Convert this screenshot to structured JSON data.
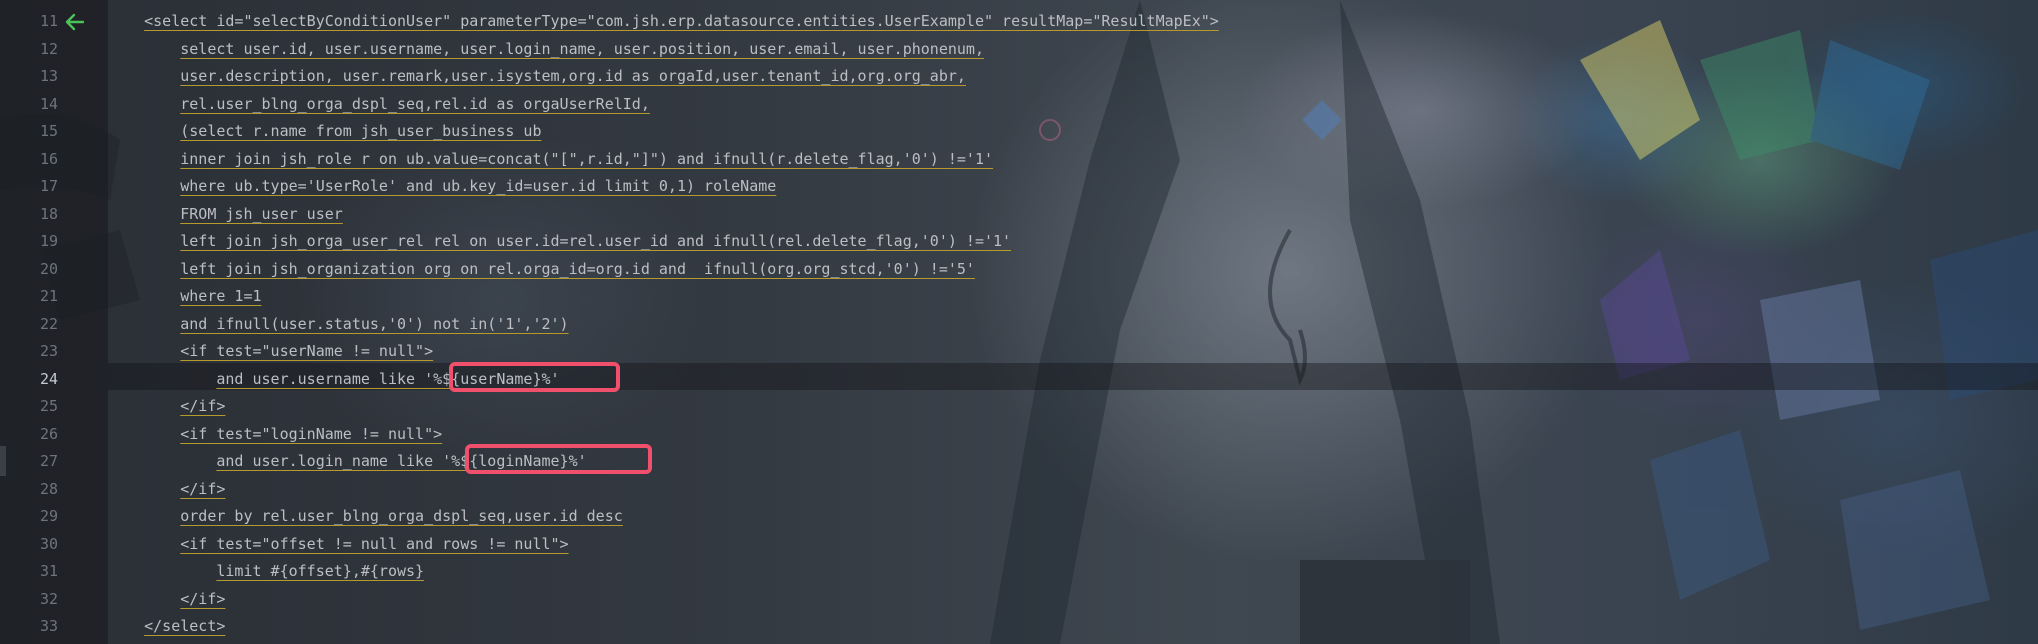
{
  "editor": {
    "colors": {
      "highlight_border": "#f0506b",
      "line_number": "#6e747d",
      "active_line_number": "#c5c9d0",
      "code_text": "#bcbec4",
      "warning_underline": "#b79a2e",
      "gutter_arrow": "#4cc25b"
    },
    "gutter_icon": "left-arrow-icon",
    "active_line": "24",
    "lines": [
      {
        "num": "11",
        "indent": "    ",
        "text": "<select id=\"selectByConditionUser\" parameterType=\"com.jsh.erp.datasource.entities.UserExample\" resultMap=\"ResultMapEx\">"
      },
      {
        "num": "12",
        "indent": "        ",
        "text": "select user.id, user.username, user.login_name, user.position, user.email, user.phonenum,"
      },
      {
        "num": "13",
        "indent": "        ",
        "text": "user.description, user.remark,user.isystem,org.id as orgaId,user.tenant_id,org.org_abr,"
      },
      {
        "num": "14",
        "indent": "        ",
        "text": "rel.user_blng_orga_dspl_seq,rel.id as orgaUserRelId,"
      },
      {
        "num": "15",
        "indent": "        ",
        "text": "(select r.name from jsh_user_business ub"
      },
      {
        "num": "16",
        "indent": "        ",
        "text": "inner join jsh_role r on ub.value=concat(\"[\",r.id,\"]\") and ifnull(r.delete_flag,'0') !='1'"
      },
      {
        "num": "17",
        "indent": "        ",
        "text": "where ub.type='UserRole' and ub.key_id=user.id limit 0,1) roleName"
      },
      {
        "num": "18",
        "indent": "        ",
        "text": "FROM jsh_user user"
      },
      {
        "num": "19",
        "indent": "        ",
        "text": "left join jsh_orga_user_rel rel on user.id=rel.user_id and ifnull(rel.delete_flag,'0') !='1'"
      },
      {
        "num": "20",
        "indent": "        ",
        "text": "left join jsh_organization org on rel.orga_id=org.id and  ifnull(org.org_stcd,'0') !='5'"
      },
      {
        "num": "21",
        "indent": "        ",
        "text": "where 1=1"
      },
      {
        "num": "22",
        "indent": "        ",
        "text": "and ifnull(user.status,'0') not in('1','2')"
      },
      {
        "num": "23",
        "indent": "        ",
        "text": "<if test=\"userName != null\">"
      },
      {
        "num": "24",
        "indent": "            ",
        "text": "and user.username like '%${userName}%'"
      },
      {
        "num": "25",
        "indent": "        ",
        "text": "</if>"
      },
      {
        "num": "26",
        "indent": "        ",
        "text": "<if test=\"loginName != null\">"
      },
      {
        "num": "27",
        "indent": "            ",
        "text": "and user.login_name like '%${loginName}%'"
      },
      {
        "num": "28",
        "indent": "        ",
        "text": "</if>"
      },
      {
        "num": "29",
        "indent": "        ",
        "text": "order by rel.user_blng_orga_dspl_seq,user.id desc"
      },
      {
        "num": "30",
        "indent": "        ",
        "text": "<if test=\"offset != null and rows != null\">"
      },
      {
        "num": "31",
        "indent": "            ",
        "text": "limit #{offset},#{rows}"
      },
      {
        "num": "32",
        "indent": "        ",
        "text": "</if>"
      },
      {
        "num": "33",
        "indent": "    ",
        "text": "</select>"
      }
    ]
  }
}
